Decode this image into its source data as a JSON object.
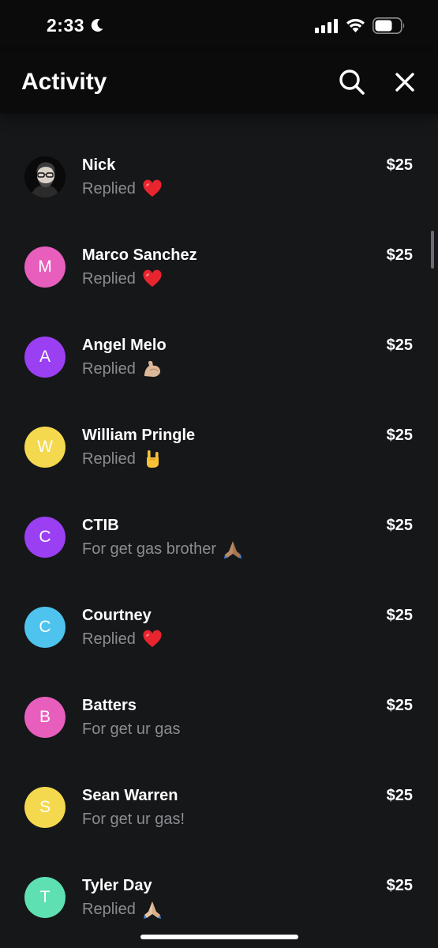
{
  "status_bar": {
    "time": "2:33",
    "moon_icon": "moon-icon",
    "signal_icon": "cellular-signal-icon",
    "wifi_icon": "wifi-icon",
    "battery_icon": "battery-icon"
  },
  "header": {
    "title": "Activity",
    "search_icon": "search-icon",
    "close_icon": "close-icon"
  },
  "colors": {
    "background": "#161719",
    "header_background": "#0b0b0c",
    "secondary_text": "#8c8c90",
    "pink": "#e85ebd",
    "purple": "#9b3ff2",
    "yellow": "#f4d94f",
    "light_blue": "#4ec3ee",
    "mint": "#5ee0b2"
  },
  "activity": [
    {
      "name": "Nick",
      "initial": "",
      "avatar_type": "photo",
      "avatar_color": "#000000",
      "subtitle": "Replied",
      "emoji": "red-heart",
      "amount": "$25"
    },
    {
      "name": "Marco Sanchez",
      "initial": "M",
      "avatar_type": "initial",
      "avatar_color": "#e85ebd",
      "subtitle": "Replied",
      "emoji": "red-heart",
      "amount": "$25"
    },
    {
      "name": "Angel Melo",
      "initial": "A",
      "avatar_type": "initial",
      "avatar_color": "#9b3ff2",
      "subtitle": "Replied",
      "emoji": "flexed-biceps",
      "amount": "$25"
    },
    {
      "name": "William Pringle",
      "initial": "W",
      "avatar_type": "initial",
      "avatar_color": "#f4d94f",
      "subtitle": "Replied",
      "emoji": "sign-of-the-horns",
      "amount": "$25"
    },
    {
      "name": "CTIB",
      "initial": "C",
      "avatar_type": "initial",
      "avatar_color": "#9b3ff2",
      "subtitle": "For get gas brother",
      "emoji": "folded-hands-medium",
      "amount": "$25"
    },
    {
      "name": "Courtney",
      "initial": "C",
      "avatar_type": "initial",
      "avatar_color": "#4ec3ee",
      "subtitle": "Replied",
      "emoji": "red-heart",
      "amount": "$25"
    },
    {
      "name": "Batters",
      "initial": "B",
      "avatar_type": "initial",
      "avatar_color": "#e85ebd",
      "subtitle": "For get ur gas",
      "emoji": "",
      "amount": "$25"
    },
    {
      "name": "Sean Warren",
      "initial": "S",
      "avatar_type": "initial",
      "avatar_color": "#f4d94f",
      "subtitle": "For get ur gas!",
      "emoji": "",
      "amount": "$25"
    },
    {
      "name": "Tyler Day",
      "initial": "T",
      "avatar_type": "initial",
      "avatar_color": "#5ee0b2",
      "subtitle": "Replied",
      "emoji": "folded-hands-light",
      "amount": "$25"
    }
  ]
}
